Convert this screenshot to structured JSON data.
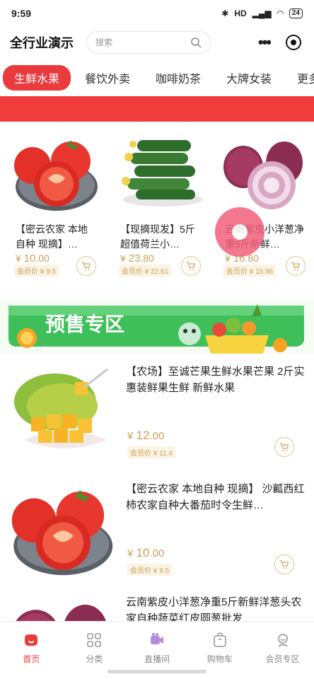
{
  "status_bar": {
    "time": "9:59",
    "network": "HD",
    "battery": "24"
  },
  "header": {
    "title": "全行业演示",
    "search_placeholder": "搜索"
  },
  "tabs": [
    {
      "label": "生鲜水果",
      "active": true
    },
    {
      "label": "餐饮外卖"
    },
    {
      "label": "咖啡奶茶"
    },
    {
      "label": "大牌女装"
    },
    {
      "label": "更多"
    }
  ],
  "grid_products": [
    {
      "title": "【密云农家 本地自种 现摘】…",
      "currency": "¥",
      "price_int": "10",
      "price_dec": ".00",
      "member_price": "会员价 ¥ 9.5",
      "image": "tomato"
    },
    {
      "title": "【现摘现发】5斤超值荷兰小…",
      "currency": "¥",
      "price_int": "23",
      "price_dec": ".80",
      "member_price": "会员价 ¥ 22.61",
      "image": "cucumber"
    },
    {
      "title": "云南紫皮小洋葱净重5斤新鲜…",
      "currency": "¥",
      "price_int": "16",
      "price_dec": ".80",
      "member_price": "会员价 ¥ 15.96",
      "image": "onion"
    }
  ],
  "presale_banner": {
    "text": "预售专区"
  },
  "list_products": [
    {
      "title": "【农场】至诚芒果生鲜水果芒果 2斤实惠装鲜果生鲜 新鲜水果",
      "currency": "¥",
      "price_int": "12",
      "price_dec": ".00",
      "member_price": "会员价 ¥ 11.4",
      "image": "mango"
    },
    {
      "title": "【密云农家 本地自种 现摘】 沙瓤西红柿农家自种大番茄时令生鲜…",
      "currency": "¥",
      "price_int": "10",
      "price_dec": ".00",
      "member_price": "会员价 ¥ 9.5",
      "image": "tomato"
    },
    {
      "title": "云南紫皮小洋葱净重5斤新鲜洋葱头农家自种蔬菜红皮圆葱批发",
      "image": "onion"
    }
  ],
  "tab_bar": [
    {
      "label": "首页",
      "icon": "home-icon",
      "active": true
    },
    {
      "label": "分类",
      "icon": "grid-icon"
    },
    {
      "label": "直播间",
      "icon": "live-camera-icon"
    },
    {
      "label": "购物车",
      "icon": "bag-icon"
    },
    {
      "label": "会员专区",
      "icon": "member-icon"
    }
  ],
  "colors": {
    "accent": "#e93b3d",
    "gold": "#c9a15a",
    "banner_green": "#3fbf5a"
  }
}
